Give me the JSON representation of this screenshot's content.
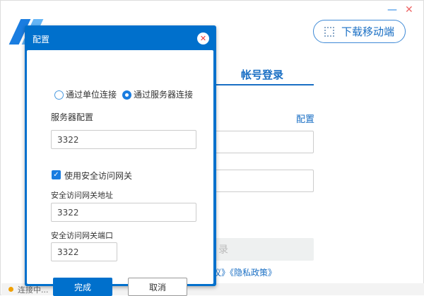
{
  "window": {
    "minimize_icon": "minimize-icon",
    "close_icon": "close-icon"
  },
  "header": {
    "download_label": "下载移动端"
  },
  "login": {
    "tab_label": "帐号登录",
    "config_link": "配置",
    "login_button": "录",
    "links": "议》《隐私政策》"
  },
  "status": {
    "text": "连接中..."
  },
  "colors": {
    "primary": "#0070cc",
    "status_dot": "#f0a000"
  },
  "dialog": {
    "title": "配置",
    "radio_unit": "通过单位连接",
    "radio_server": "通过服务器连接",
    "selected": "通过服务器连接",
    "server_label": "服务器配置",
    "server_value": "3322",
    "gateway_checkbox": "使用安全访问网关",
    "gateway_checked": true,
    "gateway_addr_label": "安全访问网关地址",
    "gateway_addr_value": "3322",
    "gateway_port_label": "安全访问网关端口",
    "gateway_port_value": "3322",
    "ok_label": "完成",
    "cancel_label": "取消"
  }
}
